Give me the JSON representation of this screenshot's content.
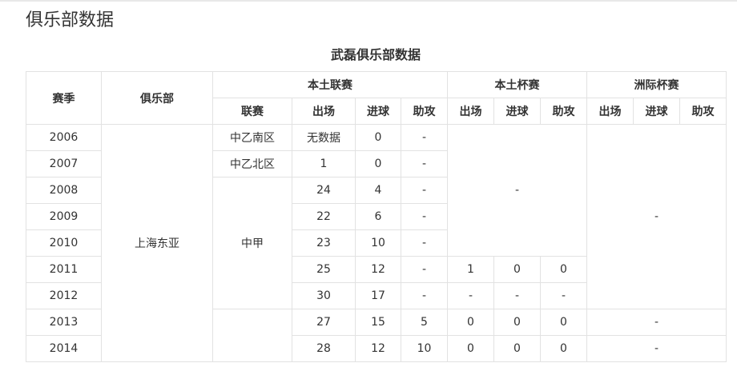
{
  "page": {
    "section_title": "俱乐部数据"
  },
  "table": {
    "caption": "武磊俱乐部数据",
    "headers": {
      "season": "赛季",
      "club": "俱乐部",
      "domestic_league": "本土联赛",
      "domestic_cup": "本土杯赛",
      "continental_cup": "洲际杯赛",
      "league": "联赛",
      "apps": "出场",
      "goals": "进球",
      "assists": "助攻"
    },
    "club": "上海东亚",
    "leagues": {
      "l2006": "中乙南区",
      "l2007": "中乙北区",
      "l2008": "中甲"
    },
    "rows": [
      {
        "season": "2006",
        "apps": "无数据",
        "goals": "0",
        "assists": "-"
      },
      {
        "season": "2007",
        "apps": "1",
        "goals": "0",
        "assists": "-"
      },
      {
        "season": "2008",
        "apps": "24",
        "goals": "4",
        "assists": "-"
      },
      {
        "season": "2009",
        "apps": "22",
        "goals": "6",
        "assists": "-"
      },
      {
        "season": "2010",
        "apps": "23",
        "goals": "10",
        "assists": "-"
      },
      {
        "season": "2011",
        "apps": "25",
        "goals": "12",
        "assists": "-"
      },
      {
        "season": "2012",
        "apps": "30",
        "goals": "17",
        "assists": "-"
      },
      {
        "season": "2013",
        "apps": "27",
        "goals": "15",
        "assists": "5"
      },
      {
        "season": "2014",
        "apps": "28",
        "goals": "12",
        "assists": "10"
      }
    ],
    "cup": {
      "early_merged": "-",
      "r2011": {
        "apps": "1",
        "goals": "0",
        "assists": "0"
      },
      "r2012": {
        "apps": "-",
        "goals": "-",
        "assists": "-"
      },
      "r2013": {
        "apps": "0",
        "goals": "0",
        "assists": "0"
      },
      "r2014": {
        "apps": "0",
        "goals": "0",
        "assists": "0"
      }
    },
    "continental": {
      "early_merged": "-",
      "r2013": "-",
      "r2014": "-"
    }
  }
}
